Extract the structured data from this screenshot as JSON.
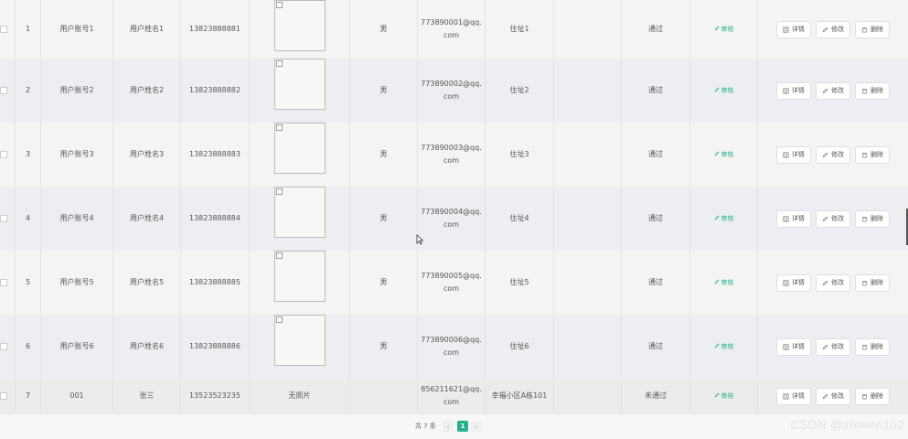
{
  "table": {
    "rows": [
      {
        "index": "1",
        "account": "用户账号1",
        "name": "用户姓名1",
        "phone": "13823888881",
        "photo": "",
        "gender": "男",
        "email_line1": "773890001@qq.",
        "email_line2": "com",
        "address": "住址1",
        "status": "通过",
        "audit": "审核"
      },
      {
        "index": "2",
        "account": "用户账号2",
        "name": "用户姓名2",
        "phone": "13823888882",
        "photo": "",
        "gender": "男",
        "email_line1": "773890002@qq.",
        "email_line2": "com",
        "address": "住址2",
        "status": "通过",
        "audit": "审核"
      },
      {
        "index": "3",
        "account": "用户账号3",
        "name": "用户姓名3",
        "phone": "13823888883",
        "photo": "",
        "gender": "男",
        "email_line1": "773890003@qq.",
        "email_line2": "com",
        "address": "住址3",
        "status": "通过",
        "audit": "审核"
      },
      {
        "index": "4",
        "account": "用户账号4",
        "name": "用户姓名4",
        "phone": "13823888884",
        "photo": "",
        "gender": "男",
        "email_line1": "773890004@qq.",
        "email_line2": "com",
        "address": "住址4",
        "status": "通过",
        "audit": "审核"
      },
      {
        "index": "5",
        "account": "用户账号5",
        "name": "用户姓名5",
        "phone": "13823888885",
        "photo": "",
        "gender": "男",
        "email_line1": "773890005@qq.",
        "email_line2": "com",
        "address": "住址5",
        "status": "通过",
        "audit": "审核"
      },
      {
        "index": "6",
        "account": "用户账号6",
        "name": "用户姓名6",
        "phone": "13823888886",
        "photo": "",
        "gender": "男",
        "email_line1": "773890006@qq.",
        "email_line2": "com",
        "address": "住址6",
        "status": "通过",
        "audit": "审核"
      },
      {
        "index": "7",
        "account": "001",
        "name": "张三",
        "phone": "13523523235",
        "photo": "无照片",
        "gender": "",
        "email_line1": "856211621@qq.",
        "email_line2": "com",
        "address": "幸福小区A栋101",
        "status": "未通过",
        "audit": "审核"
      }
    ],
    "actions": {
      "detail": "详情",
      "edit": "修改",
      "delete": "删除"
    }
  },
  "pagination": {
    "total_text": "共 7 条",
    "current_page": "1",
    "prev": "‹",
    "next": "›"
  },
  "watermark": "CSDN @zhiwen102",
  "colors": {
    "accent": "#27b08c"
  }
}
